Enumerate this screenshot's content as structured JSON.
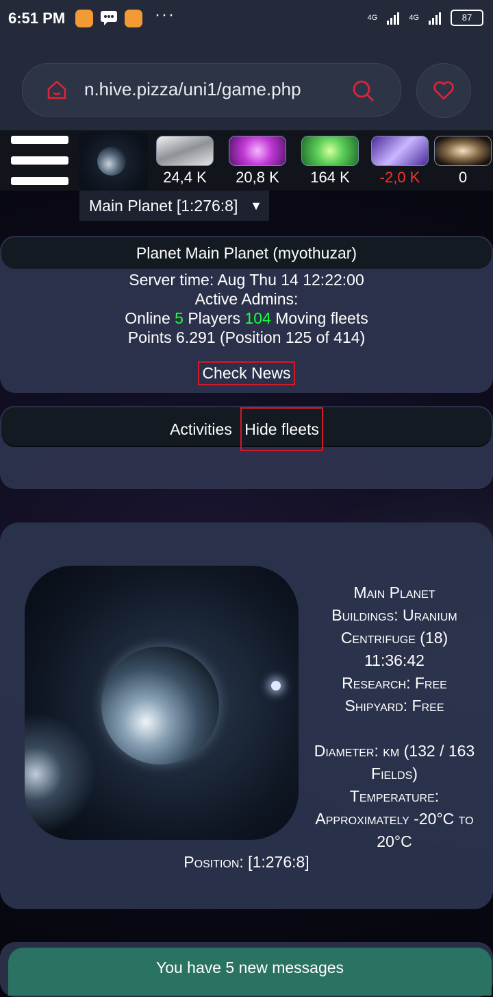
{
  "status_bar": {
    "time": "6:51 PM",
    "network_1": "4G",
    "network_2": "4G",
    "battery": "87"
  },
  "browser": {
    "url": "n.hive.pizza/uni1/game.php"
  },
  "resources": {
    "items": [
      {
        "name": "metal",
        "value": "24,4 K",
        "color": "#c9ccd1"
      },
      {
        "name": "crystal",
        "value": "20,8 K",
        "color": "#c03ad6"
      },
      {
        "name": "deuterium",
        "value": "164 K",
        "color": "#5fd05a"
      },
      {
        "name": "energy",
        "value": "-2,0 K",
        "color": "#8b5ce6",
        "negative": true
      },
      {
        "name": "dark-matter",
        "value": "0",
        "color": "#b89a6e"
      }
    ]
  },
  "planet_select": {
    "selected": "Main Planet [1:276:8]",
    "arrow": "▼"
  },
  "overview": {
    "title": "Planet Main Planet (myothuzar)",
    "server_time": "Server time: Aug Thu 14 12:22:00",
    "active_admins": "Active Admins:",
    "online_prefix": "Online",
    "online_count": "5",
    "players_label": "Players",
    "players_count": "104",
    "moving_fleets": "Moving fleets",
    "points": "Points 6.291 (Position 125 of 414)",
    "check_news": "Check News"
  },
  "activities": {
    "label": "Activities",
    "hide_fleets": "Hide fleets"
  },
  "planet_detail": {
    "name": "Main Planet",
    "buildings": "Buildings: Uranium Centrifuge (18) 11:36:42",
    "research": "Research: Free",
    "shipyard": "Shipyard: Free",
    "diameter": "Diameter: km (132 / 163 Fields)",
    "temperature": "Temperature: Approximately -20°C to 20°C",
    "position": "Position: [1:276:8]"
  },
  "messages": {
    "text": "You have 5 new messages"
  }
}
